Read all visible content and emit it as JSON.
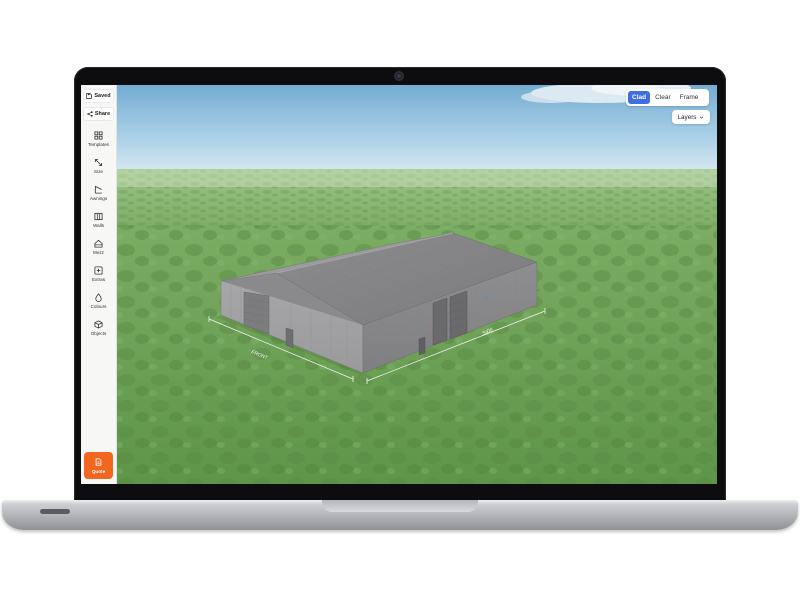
{
  "sidebar": {
    "saved_label": "Saved",
    "share_label": "Share",
    "items": [
      {
        "label": "Templates",
        "icon": "grid-icon"
      },
      {
        "label": "Size",
        "icon": "resize-arrows-icon"
      },
      {
        "label": "Awnings",
        "icon": "awning-icon"
      },
      {
        "label": "Walls",
        "icon": "walls-icon"
      },
      {
        "label": "Mezz",
        "icon": "mezzanine-icon"
      },
      {
        "label": "Extras",
        "icon": "extras-icon"
      },
      {
        "label": "Colours",
        "icon": "droplet-icon"
      },
      {
        "label": "Objects",
        "icon": "cube-icon"
      }
    ],
    "quote_label": "Quote"
  },
  "view_modes": {
    "options": [
      "Clad",
      "Clear",
      "Frame"
    ],
    "active": "Clad"
  },
  "layers_label": "Layers",
  "building": {
    "front_dimension_label": "FRONT",
    "side_dimension_label": "SIDE"
  },
  "colors": {
    "accent_blue": "#3d6fe0",
    "quote_orange": "#f2661f",
    "sky_top": "#7eb6d8",
    "grass": "#6b9e57",
    "building_grey": "#8f8f91"
  }
}
